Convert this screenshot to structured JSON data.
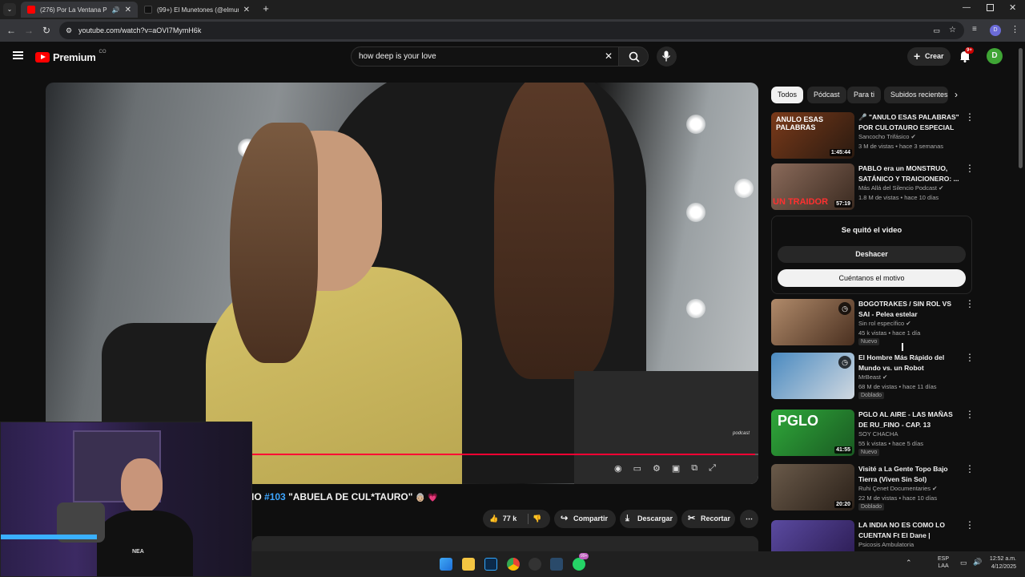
{
  "browser": {
    "tabs": [
      {
        "title": "(276) Por La Ventana Podc",
        "active": true
      },
      {
        "title": "(99+) El Munetones (@elmune",
        "active": false
      }
    ],
    "url": "youtube.com/watch?v=aOVI7MymH6k"
  },
  "yt": {
    "logo_text": "Premium",
    "country": "CO",
    "search_value": "how deep is your love",
    "create_label": "Crear",
    "notif_badge": "9+",
    "avatar_letter": "D"
  },
  "video": {
    "title_partial": "IO",
    "hashtag": "#103",
    "title_rest": "\"ABUELA DE CUL*TAURO\"",
    "title_emoji": "👵🏼 💗",
    "likes": "77 k",
    "share_label": "Compartir",
    "download_label": "Descargar",
    "clip_label": "Recortar",
    "progress_fraction": 0.995
  },
  "chips": [
    "Todos",
    "Pódcast",
    "Para ti",
    "Subidos recientes"
  ],
  "recs_top": [
    {
      "title": "🎤 \"ANULO ESAS PALABRAS\" POR CULOTAURO ESPECIAL ...",
      "channel": "Sancocho Trifásico",
      "verified": true,
      "meta": "3 M de vistas • hace 3 semanas",
      "duration": "1:45:44",
      "thumb_color": "#5a2a1a",
      "thumb_text": "ANULO ESAS PALABRAS"
    },
    {
      "title": "PABLO era un MONSTRUO, SATÁNICO Y TRAICIONERO: ...",
      "channel": "Más Allá del Silencio Podcast",
      "verified": true,
      "meta": "1.8 M de vistas • hace 10 días",
      "duration": "57:19",
      "thumb_color": "#6a4a3a",
      "thumb_text": "UN TRAIDOR"
    }
  ],
  "removed": {
    "message": "Se quitó el video",
    "undo_label": "Deshacer",
    "tell_label": "Cuéntanos el motivo"
  },
  "recs_bottom": [
    {
      "title": "BOGOTRAKES / SIN ROL VS SAI - Pelea estelar",
      "channel": "Sin rol específico",
      "verified": true,
      "meta": "45 k vistas • hace 1 día",
      "badge": "Nuevo",
      "duration": "",
      "thumb_color": "#7a5a3a",
      "clock": true
    },
    {
      "title": "El Hombre Más Rápido del Mundo vs. un Robot",
      "channel": "MrBeast",
      "verified": true,
      "meta": "68 M de vistas • hace 11 días",
      "badge": "Doblado",
      "duration": "",
      "thumb_color": "#3a6a9a",
      "clock": true
    },
    {
      "title": "PGLO AL AIRE - LAS MAÑAS DE RU_FINO - CAP. 13",
      "channel": "SOY CHACHA",
      "verified": false,
      "meta": "55 k vistas • hace 5 días",
      "badge": "Nuevo",
      "duration": "41:55",
      "thumb_color": "#2f8a3a",
      "thumb_text": "PGLO"
    },
    {
      "title": "Visité a La Gente Topo Bajo Tierra (Viven Sin Sol)",
      "channel": "Ruhi Çenet Documentaries",
      "verified": true,
      "meta": "22 M de vistas • hace 10 días",
      "badge": "Doblado",
      "duration": "20:20",
      "thumb_color": "#4a3a2a"
    },
    {
      "title": "LA INDIA NO ES COMO LO CUENTAN Ft El Dane | Psicosi...",
      "channel": "Psicosis Ambulatoria",
      "verified": false,
      "meta": "",
      "badge": "",
      "duration": "",
      "thumb_color": "#3a2a6a"
    }
  ],
  "taskbar": {
    "lang1": "ESP",
    "lang2": "LAA",
    "time": "12:52 a.m.",
    "date": "4/12/2025",
    "whatsapp_badge": "99+"
  },
  "webcam": {
    "shirt_text": "NEA"
  }
}
